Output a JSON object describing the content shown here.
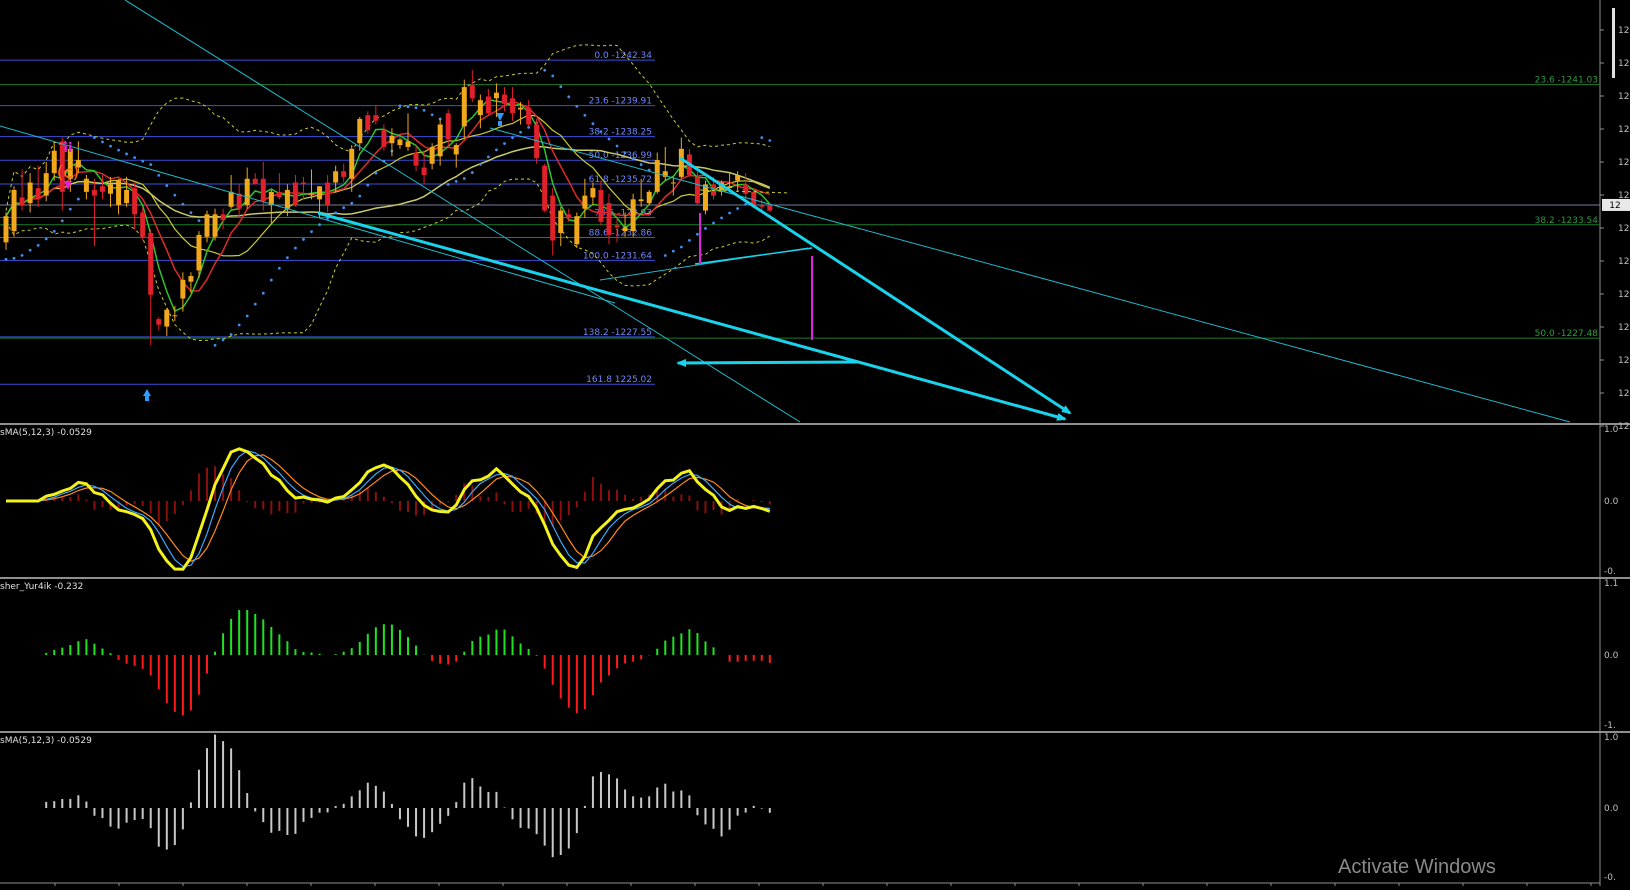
{
  "watermark": "Activate Windows",
  "colors": {
    "bull_candle": "#f0a81c",
    "bear_candle": "#e0202a",
    "fib_line": "#3b4fd8",
    "fib_text": "#6f86ff",
    "right_fib_line": "#1f7a2a",
    "right_fib_text": "#2f9a3a",
    "cyan_thick": "#19d3ec",
    "cyan_thin": "#1fb8c9",
    "psar": "#3f8ff0",
    "bb": "#cccc33",
    "ma_fast": "#2ec42e",
    "ma_mid": "#e02a2a",
    "ma_slow": "#c9c96b",
    "osma_yellow": "#f2f21c",
    "osma_blue": "#3aa8ff",
    "osma_orange": "#ff8a1a",
    "hist_red": "#8a1010",
    "fisher_green": "#1ee41e",
    "fisher_red": "#ff1a1a",
    "gray_hist": "#c8c8c8",
    "magenta": "#e020e0",
    "wave_orange": "#ff6a14",
    "panel_border": "#8f8f8f"
  },
  "panels": {
    "main": {
      "price_axis_labels": [
        "12",
        "12",
        "12",
        "12",
        "12",
        "12",
        "12",
        "12",
        "12",
        "12",
        "12",
        "12",
        "12"
      ],
      "current_price_tag": "12",
      "fib_left": [
        {
          "label": "0.0 -1242.34"
        },
        {
          "label": "23.6 -1239.91"
        },
        {
          "label": "38.2 -1238.25"
        },
        {
          "label": "50.0 -1236.99"
        },
        {
          "label": "61.8 -1235.72"
        },
        {
          "label": "78.6 -123.93"
        },
        {
          "label": "88.6 -1232.86"
        },
        {
          "label": "100.0 -1231.64"
        },
        {
          "label": "138.2  -1227.55"
        },
        {
          "label": "161.8 1225.02"
        }
      ],
      "fib_right": [
        {
          "label": "23.6 -1241.03"
        },
        {
          "label": "38.2 -1233.54"
        },
        {
          "label": "50.0 -1227.48"
        }
      ],
      "wave_labels": {
        "top": "ii",
        "circle": "(c)"
      }
    },
    "osma": {
      "title": "sMA(5,12,3) -0.0529",
      "axis_labels": [
        "1.0",
        "0.0",
        "-0."
      ]
    },
    "fisher": {
      "title": "sher_Yur4ik -0.232",
      "axis_labels": [
        "1.1",
        "0.0",
        "-1."
      ]
    },
    "osma2": {
      "title": "sMA(5,12,3) -0.0529",
      "axis_labels": [
        "1.0",
        "0.0",
        "-0."
      ]
    }
  },
  "chart_data": [
    {
      "type": "candlestick",
      "name_note": "",
      "ohlc": [
        [
          1232.6,
          1234.2,
          1232.2,
          1234.0
        ],
        [
          1233.2,
          1235.6,
          1232.9,
          1235.4
        ],
        [
          1235.0,
          1236.5,
          1234.3,
          1234.6
        ],
        [
          1234.7,
          1236.3,
          1234.2,
          1235.8
        ],
        [
          1235.5,
          1236.7,
          1234.5,
          1234.9
        ],
        [
          1235.1,
          1236.9,
          1234.8,
          1236.3
        ],
        [
          1236.3,
          1237.9,
          1235.9,
          1237.5
        ],
        [
          1238.0,
          1238.2,
          1234.3,
          1235.3
        ],
        [
          1236.0,
          1237.7,
          1235.3,
          1237.6
        ],
        [
          1236.6,
          1238.0,
          1236.3,
          1237.0
        ],
        [
          1235.3,
          1236.2,
          1234.9,
          1236.0
        ],
        [
          1235.4,
          1236.0,
          1232.4,
          1235.1
        ],
        [
          1235.6,
          1236.2,
          1234.9,
          1235.3
        ],
        [
          1235.2,
          1236.1,
          1234.5,
          1235.7
        ],
        [
          1234.6,
          1236.0,
          1234.1,
          1235.9
        ],
        [
          1234.7,
          1236.1,
          1234.5,
          1235.4
        ],
        [
          1235.5,
          1235.8,
          1233.3,
          1234.1
        ],
        [
          1234.2,
          1234.5,
          1232.7,
          1232.9
        ],
        [
          1233.1,
          1233.3,
          1227.1,
          1229.8
        ],
        [
          1228.5,
          1228.6,
          1227.9,
          1228.2
        ],
        [
          1228.1,
          1229.1,
          1227.6,
          1229.0
        ],
        [
          1228.7,
          1229.2,
          1228.4,
          1228.7
        ],
        [
          1229.6,
          1231.0,
          1228.9,
          1230.6
        ],
        [
          1230.5,
          1231.0,
          1229.9,
          1230.8
        ],
        [
          1231.1,
          1233.2,
          1230.7,
          1233.0
        ],
        [
          1232.9,
          1234.3,
          1232.6,
          1234.1
        ],
        [
          1232.9,
          1234.4,
          1232.7,
          1234.1
        ],
        [
          1234.1,
          1234.4,
          1233.3,
          1233.8
        ],
        [
          1234.5,
          1236.2,
          1234.4,
          1235.3
        ],
        [
          1235.2,
          1235.7,
          1233.9,
          1234.4
        ],
        [
          1234.6,
          1236.6,
          1234.4,
          1236.0
        ],
        [
          1236.0,
          1236.3,
          1235.7,
          1235.7
        ],
        [
          1236.0,
          1236.9,
          1234.3,
          1234.8
        ],
        [
          1234.6,
          1235.4,
          1233.6,
          1235.3
        ],
        [
          1235.3,
          1236.3,
          1234.9,
          1235.0
        ],
        [
          1234.4,
          1235.7,
          1234.0,
          1235.4
        ],
        [
          1235.8,
          1236.2,
          1234.5,
          1234.6
        ],
        [
          1235.8,
          1236.1,
          1234.9,
          1235.7
        ],
        [
          1235.2,
          1236.5,
          1234.9,
          1235.2
        ],
        [
          1234.9,
          1235.6,
          1233.9,
          1235.6
        ],
        [
          1235.8,
          1236.2,
          1234.2,
          1234.6
        ],
        [
          1235.8,
          1236.7,
          1235.3,
          1236.4
        ],
        [
          1236.4,
          1236.8,
          1235.8,
          1236.1
        ],
        [
          1236.0,
          1237.8,
          1235.3,
          1237.6
        ],
        [
          1237.9,
          1239.3,
          1237.5,
          1239.2
        ],
        [
          1239.4,
          1239.6,
          1238.4,
          1238.6
        ],
        [
          1239.4,
          1239.9,
          1238.9,
          1239.1
        ],
        [
          1238.6,
          1238.9,
          1237.5,
          1237.7
        ],
        [
          1237.9,
          1238.7,
          1237.2,
          1238.3
        ],
        [
          1237.8,
          1238.2,
          1237.6,
          1238.1
        ],
        [
          1237.7,
          1239.5,
          1237.5,
          1238.0
        ],
        [
          1237.4,
          1237.8,
          1236.4,
          1236.7
        ],
        [
          1236.6,
          1237.5,
          1235.7,
          1236.2
        ],
        [
          1236.8,
          1237.9,
          1236.5,
          1237.7
        ],
        [
          1237.2,
          1239.2,
          1236.7,
          1238.9
        ],
        [
          1239.5,
          1239.7,
          1237.7,
          1238.1
        ],
        [
          1237.3,
          1237.9,
          1236.6,
          1237.8
        ],
        [
          1238.8,
          1241.3,
          1238.2,
          1240.9
        ],
        [
          1241.0,
          1241.8,
          1240.1,
          1240.3
        ],
        [
          1239.4,
          1240.5,
          1238.7,
          1240.2
        ],
        [
          1240.4,
          1240.8,
          1239.4,
          1239.5
        ],
        [
          1240.3,
          1241.1,
          1239.3,
          1240.6
        ],
        [
          1240.5,
          1240.9,
          1239.6,
          1240.0
        ],
        [
          1240.3,
          1240.9,
          1239.1,
          1239.5
        ],
        [
          1239.7,
          1240.1,
          1238.9,
          1239.8
        ],
        [
          1239.8,
          1240.2,
          1238.8,
          1238.9
        ],
        [
          1238.9,
          1239.2,
          1236.8,
          1237.1
        ],
        [
          1236.7,
          1236.8,
          1234.2,
          1234.3
        ],
        [
          1235.1,
          1235.5,
          1231.9,
          1232.7
        ],
        [
          1233.1,
          1234.5,
          1232.4,
          1234.3
        ],
        [
          1234.1,
          1234.4,
          1233.7,
          1233.9
        ],
        [
          1232.5,
          1234.2,
          1232.3,
          1234.0
        ],
        [
          1234.4,
          1236.0,
          1233.9,
          1235.1
        ],
        [
          1235.0,
          1235.8,
          1234.6,
          1235.5
        ],
        [
          1235.4,
          1235.9,
          1233.5,
          1233.7
        ],
        [
          1234.7,
          1235.2,
          1232.5,
          1233.0
        ],
        [
          1233.5,
          1233.9,
          1232.6,
          1233.4
        ],
        [
          1233.2,
          1234.2,
          1232.9,
          1233.4
        ],
        [
          1233.2,
          1235.2,
          1232.9,
          1234.9
        ],
        [
          1234.8,
          1236.0,
          1234.5,
          1234.9
        ],
        [
          1234.7,
          1235.4,
          1234.6,
          1235.3
        ],
        [
          1235.3,
          1237.4,
          1235.2,
          1237.0
        ],
        [
          1236.1,
          1237.7,
          1235.9,
          1236.4
        ],
        [
          1235.8,
          1236.1,
          1235.1,
          1235.8
        ],
        [
          1236.1,
          1238.2,
          1236.0,
          1237.6
        ],
        [
          1237.3,
          1237.6,
          1236.1,
          1236.2
        ],
        [
          1236.1,
          1236.4,
          1234.6,
          1234.7
        ],
        [
          1234.3,
          1235.9,
          1234.1,
          1235.7
        ],
        [
          1235.7,
          1236.1,
          1234.9,
          1235.1
        ],
        [
          1235.4,
          1235.9,
          1235.1,
          1235.8
        ],
        [
          1235.5,
          1236.3,
          1235.3,
          1235.6
        ],
        [
          1235.9,
          1236.4,
          1235.3,
          1236.2
        ],
        [
          1235.7,
          1236.3,
          1234.8,
          1235.2
        ],
        [
          1235.3,
          1235.5,
          1234.5,
          1234.6
        ],
        [
          1234.6,
          1234.9,
          1234.3,
          1234.5
        ],
        [
          1234.6,
          1234.7,
          1234.2,
          1234.3
        ]
      ]
    }
  ]
}
